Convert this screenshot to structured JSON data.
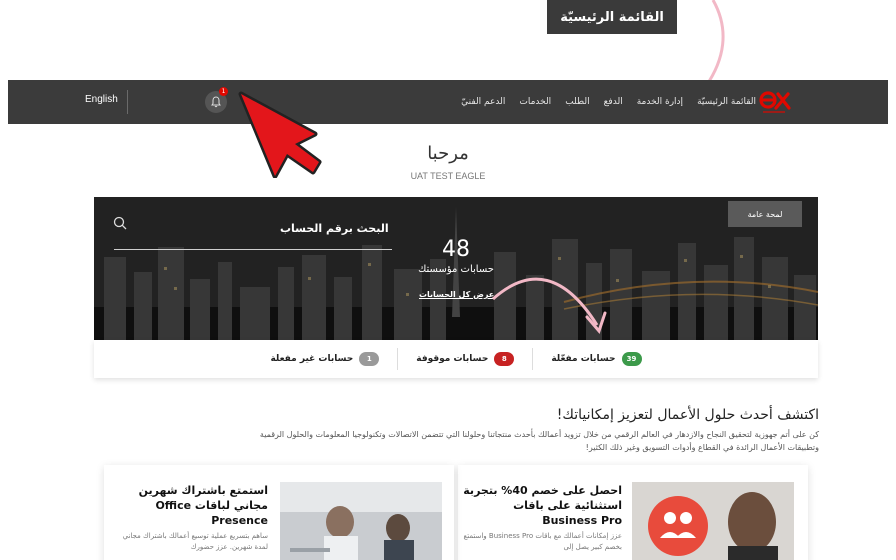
{
  "tooltip": {
    "text": "القائمة الرئيسيّة"
  },
  "nav": {
    "language": "English",
    "notification_count": "1",
    "items": [
      "القائمة الرئيسيّة",
      "إدارة الخدمة",
      "الدفع",
      "الطلب",
      "الخدمات",
      "الدعم الفنيّ"
    ]
  },
  "welcome": {
    "title": "مرحبا",
    "user": "UAT TEST EAGLE"
  },
  "hero": {
    "overview_button": "لمحة عامة",
    "search_label": "البحث برقم الحساب",
    "accounts_count": "48",
    "accounts_label": "حسابات مؤسستك",
    "view_all": "عرض كل الحسابات"
  },
  "stats": {
    "active": {
      "label": "حسابات مفعّلة",
      "count": "39",
      "color": "#3c9a4a"
    },
    "suspended": {
      "label": "حسابات موقوفة",
      "count": "8",
      "color": "#c72222"
    },
    "inactive": {
      "label": "حسابات غير مفعلة",
      "count": "1",
      "color": "#9a9a9a"
    }
  },
  "discover": {
    "title": "اكتشف أحدث حلول الأعمال لتعزيز إمكانياتك!",
    "text": "كن على أتم جهوزية لتحقيق النجاح والازدهار في العالم الرقمي من خلال تزويد أعمالك بأحدث منتجاتنا وحلولنا التي تتضمن الاتصالات وتكنولوجيا المعلومات والحلول الرقمية وتطبيقات الأعمال الرائدة في القطاع وأدوات التسويق وغير ذلك الكثير!"
  },
  "cards": [
    {
      "title": "احصل على خصم 40% بتجربة استثنائية على باقات Business Pro",
      "text": "عزز إمكانات أعمالك مع باقات Business Pro واستمتع بخصم كبير يصل إلى"
    },
    {
      "title": "استمتع باشتراك شهرين مجاني لباقات Office Presence",
      "text": "ساهم بتسريع عملية توسيع أعمالك باشتراك مجاني لمدة شهرين. عزز حضورك"
    }
  ],
  "colors": {
    "brand": "#e00800",
    "navbar": "#3b3b3b"
  }
}
